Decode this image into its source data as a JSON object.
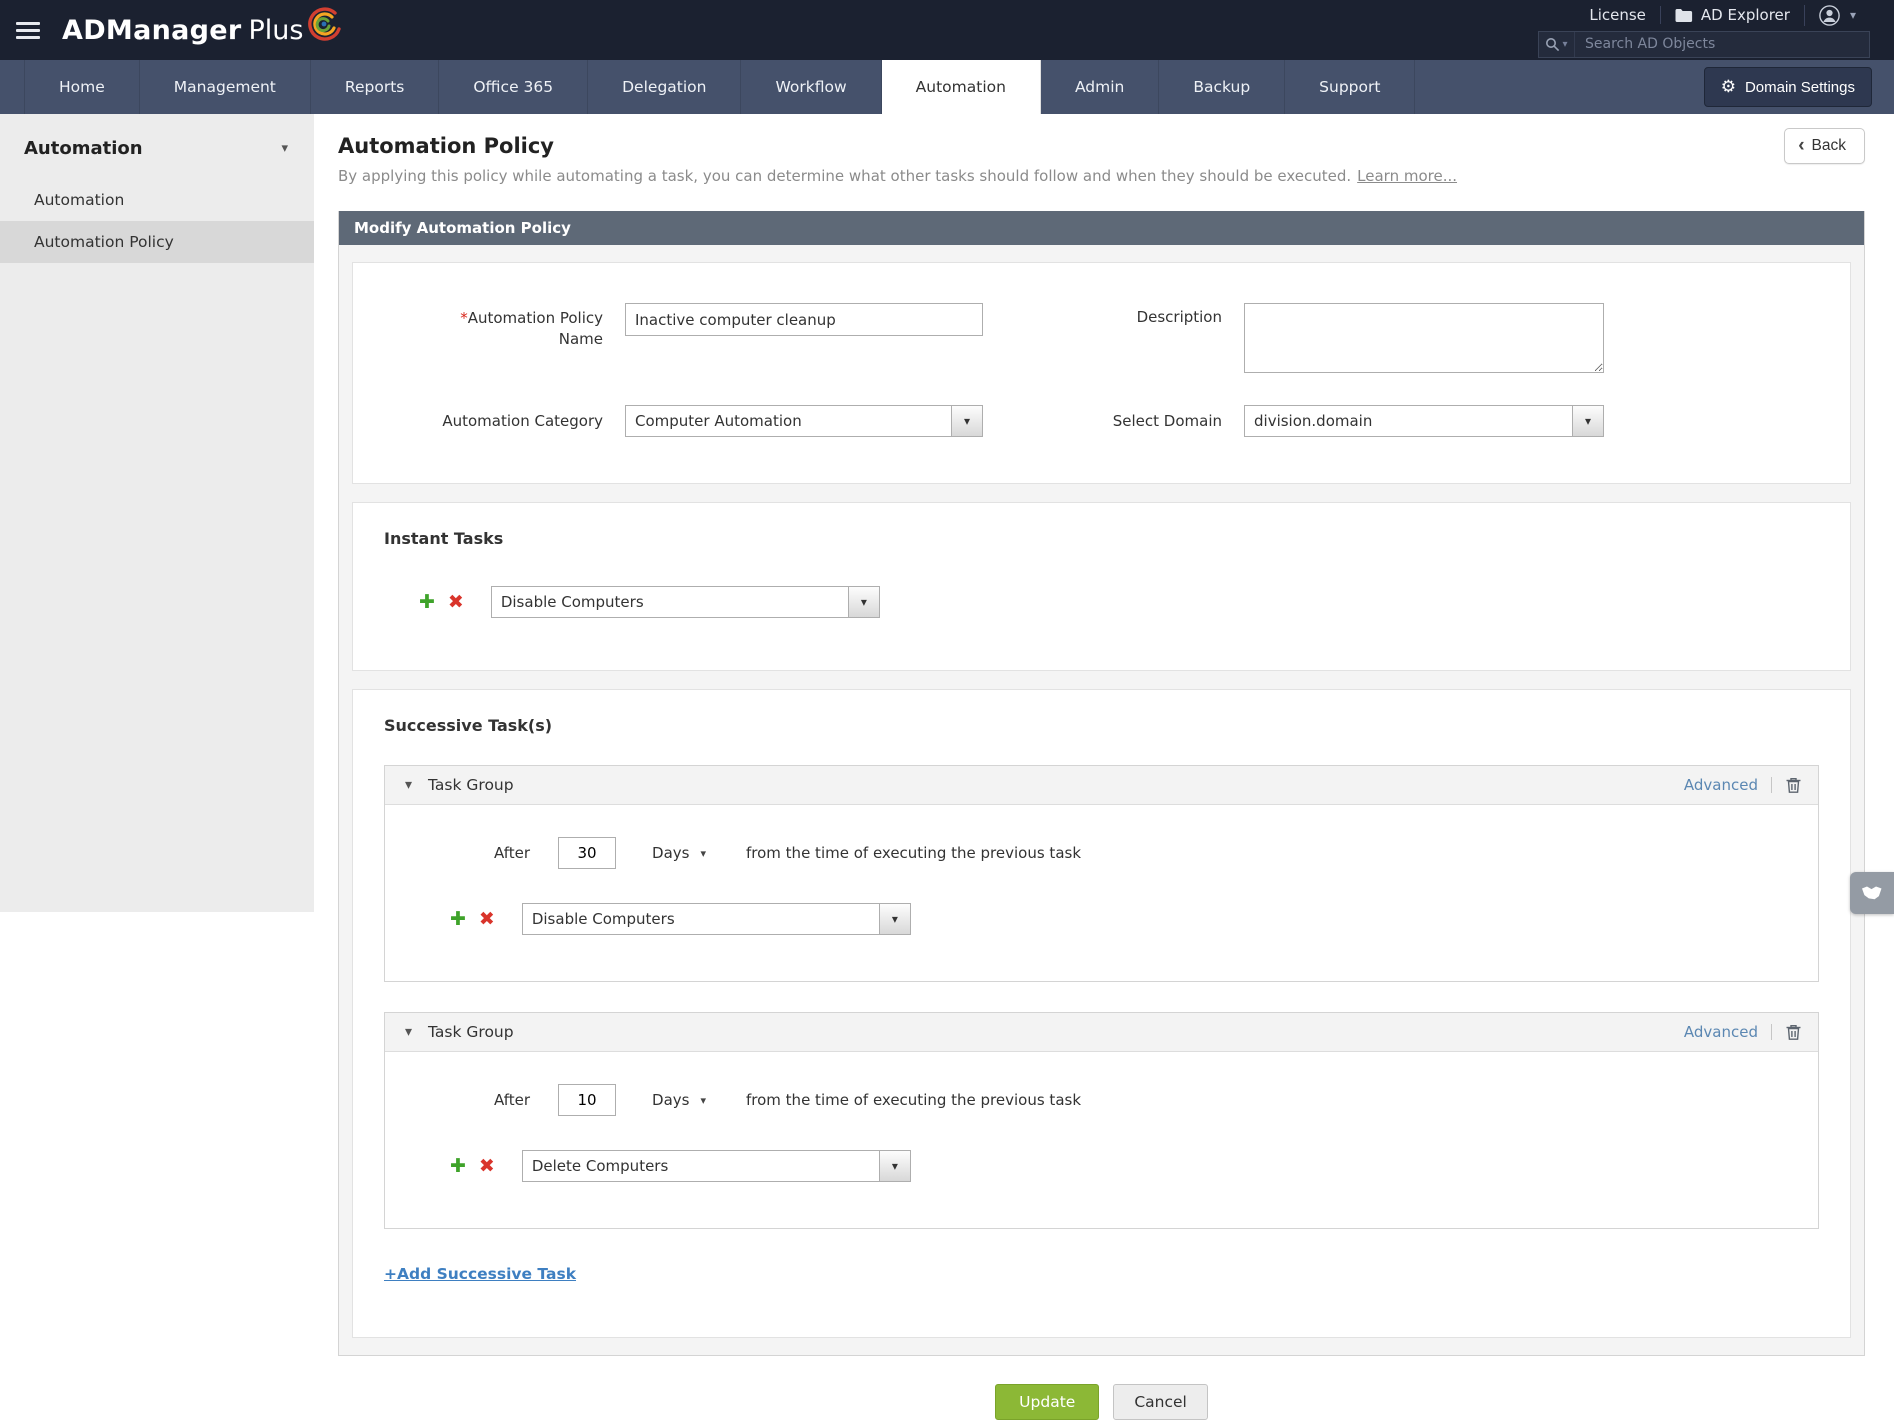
{
  "colors": {
    "topbar_bg": "#1b2130",
    "nav_bg": "#45516b",
    "panel_header_bg": "#5e6977",
    "accent_green": "#8cb836",
    "plus_green": "#3fa32a",
    "danger_red": "#d9342b",
    "link_blue": "#3e7fc1",
    "advanced_link_blue": "#5b87b2",
    "sidebar_bg": "#ececec",
    "sidebar_selected_bg": "#d8d8d8"
  },
  "icons": {
    "caret_down": "▾",
    "back_chevron": "‹",
    "plus": "✚",
    "remove": "✖",
    "gear": "⚙"
  },
  "topbar": {
    "brand_primary": "ADManager",
    "brand_secondary": "Plus",
    "license_label": "License",
    "ad_explorer_label": "AD Explorer",
    "search_placeholder": "Search AD Objects"
  },
  "nav": {
    "tabs": [
      {
        "label": "Home"
      },
      {
        "label": "Management"
      },
      {
        "label": "Reports"
      },
      {
        "label": "Office 365"
      },
      {
        "label": "Delegation"
      },
      {
        "label": "Workflow"
      },
      {
        "label": "Automation",
        "active": true
      },
      {
        "label": "Admin"
      },
      {
        "label": "Backup"
      },
      {
        "label": "Support"
      }
    ],
    "domain_settings_label": "Domain Settings"
  },
  "sidebar": {
    "header": "Automation",
    "items": [
      {
        "label": "Automation"
      },
      {
        "label": "Automation Policy",
        "selected": true
      }
    ]
  },
  "page": {
    "title": "Automation Policy",
    "subtitle": "By applying this policy while automating a task, you can determine what other tasks should follow and when they should be executed.",
    "learn_more_label": "Learn more...",
    "back_label": "Back"
  },
  "panel": {
    "header": "Modify Automation Policy",
    "form": {
      "required_marker": "*",
      "policy_name_label": "Automation Policy Name",
      "policy_name_value": "Inactive computer cleanup",
      "description_label": "Description",
      "description_value": "",
      "category_label": "Automation Category",
      "category_value": "Computer Automation",
      "domain_label": "Select Domain",
      "domain_value": "division.domain"
    },
    "instant_tasks": {
      "title": "Instant Tasks",
      "task_value": "Disable Computers"
    },
    "successive_tasks": {
      "title": "Successive Task(s)",
      "groups": [
        {
          "title": "Task Group",
          "advanced_label": "Advanced",
          "after_label": "After",
          "after_value": "30",
          "unit_value": "Days",
          "after_suffix": "from the time of executing the previous task",
          "task_value": "Disable Computers"
        },
        {
          "title": "Task Group",
          "advanced_label": "Advanced",
          "after_label": "After",
          "after_value": "10",
          "unit_value": "Days",
          "after_suffix": "from the time of executing the previous task",
          "task_value": "Delete Computers"
        }
      ],
      "add_task_label": "+Add Successive Task"
    }
  },
  "footer": {
    "update_label": "Update",
    "cancel_label": "Cancel"
  }
}
